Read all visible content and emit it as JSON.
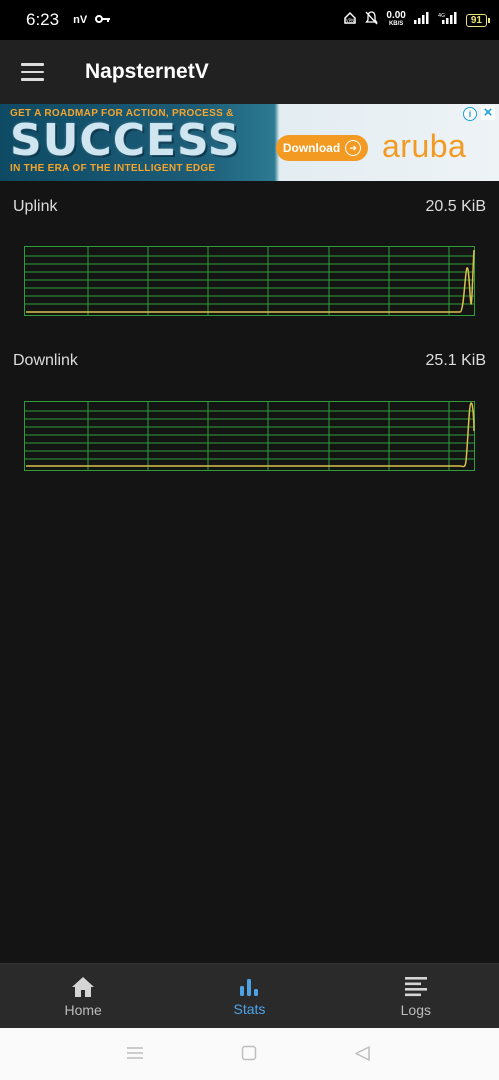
{
  "status_bar": {
    "time": "6:23",
    "app_indicator": "nV",
    "net_speed_value": "0.00",
    "net_speed_unit": "KB/S",
    "battery": "91",
    "icons": [
      "key-icon",
      "vpn-icon",
      "bell-off-icon",
      "signal-icon",
      "signal-4g-icon",
      "battery-icon"
    ]
  },
  "app_bar": {
    "title": "NapsternetV",
    "menu_icon": "hamburger-menu-icon"
  },
  "ad": {
    "headline_top": "GET A ROADMAP FOR ACTION, PROCESS &",
    "headline_main": "SUCCESS",
    "headline_bottom": "IN THE ERA OF THE INTELLIGENT EDGE",
    "button_label": "Download",
    "brand": "aruba",
    "accent_color": "#f39a23"
  },
  "stats": {
    "uplink": {
      "label": "Uplink",
      "value": "20.5 KiB"
    },
    "downlink": {
      "label": "Downlink",
      "value": "25.1 KiB"
    },
    "grid_color": "#2e9e3a",
    "line_color": "#d8c24a"
  },
  "bottom_nav": {
    "items": [
      {
        "label": "Home",
        "icon": "home-icon",
        "active": false
      },
      {
        "label": "Stats",
        "icon": "bar-chart-icon",
        "active": true
      },
      {
        "label": "Logs",
        "icon": "logs-icon",
        "active": false
      }
    ],
    "active_color": "#4da3e6"
  },
  "system_nav": {
    "icons": [
      "recents-icon",
      "home-square-icon",
      "back-triangle-icon"
    ]
  }
}
